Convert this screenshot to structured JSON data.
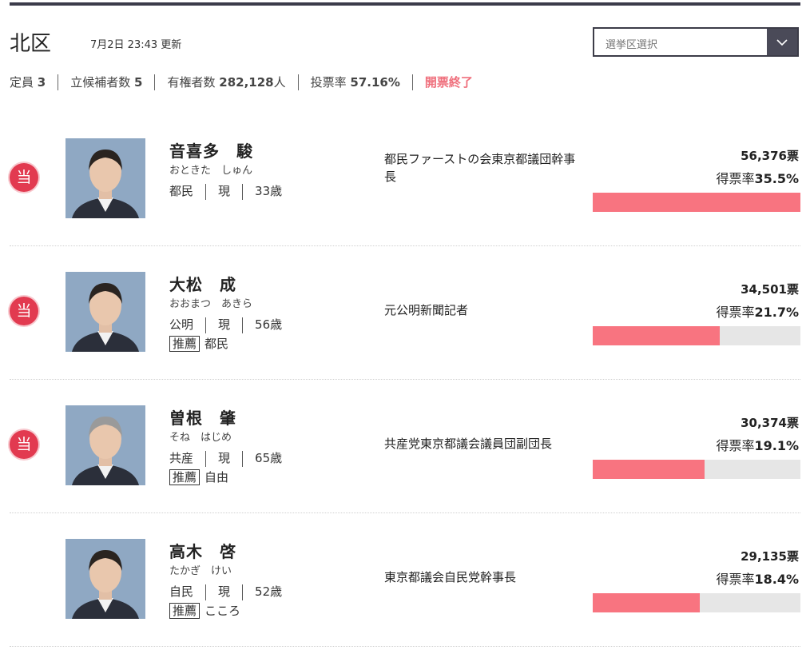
{
  "header": {
    "district": "北区",
    "updated": "7月2日 23:43 更新",
    "select_placeholder": "選挙区選択"
  },
  "stats": {
    "seats_label": "定員",
    "seats": "3",
    "candidates_label": "立候補者数",
    "candidates": "5",
    "voters_label": "有権者数",
    "voters": "282,128",
    "voters_unit": "人",
    "turnout_label": "投票率",
    "turnout": "57.16%",
    "status": "開票終了"
  },
  "colors": {
    "winner_badge": "#e23a50",
    "bar_fill": "#f87480",
    "bar_track": "#e6e6e6",
    "status": "#ef6f7c"
  },
  "candidates": [
    {
      "elected": true,
      "badge": "当",
      "name": "音喜多　駿",
      "kana": "おときた　しゅん",
      "party": "都民",
      "status": "現",
      "age": "33歳",
      "recommend_label": "",
      "recommend": "",
      "job": "都民ファーストの会東京都議団幹事長",
      "votes": "56,376票",
      "rate_label": "得票率",
      "rate": "35.5%",
      "share": 1.0
    },
    {
      "elected": true,
      "badge": "当",
      "name": "大松　成",
      "kana": "おおまつ　あきら",
      "party": "公明",
      "status": "現",
      "age": "56歳",
      "recommend_label": "推薦",
      "recommend": "都民",
      "job": "元公明新聞記者",
      "votes": "34,501票",
      "rate_label": "得票率",
      "rate": "21.7%",
      "share": 0.612
    },
    {
      "elected": true,
      "badge": "当",
      "name": "曽根　肇",
      "kana": "そね　はじめ",
      "party": "共産",
      "status": "現",
      "age": "65歳",
      "recommend_label": "推薦",
      "recommend": "自由",
      "job": "共産党東京都議会議員団副団長",
      "votes": "30,374票",
      "rate_label": "得票率",
      "rate": "19.1%",
      "share": 0.539
    },
    {
      "elected": false,
      "badge": "",
      "name": "高木　啓",
      "kana": "たかぎ　けい",
      "party": "自民",
      "status": "現",
      "age": "52歳",
      "recommend_label": "推薦",
      "recommend": "こころ",
      "job": "東京都議会自民党幹事長",
      "votes": "29,135票",
      "rate_label": "得票率",
      "rate": "18.4%",
      "share": 0.517
    }
  ]
}
